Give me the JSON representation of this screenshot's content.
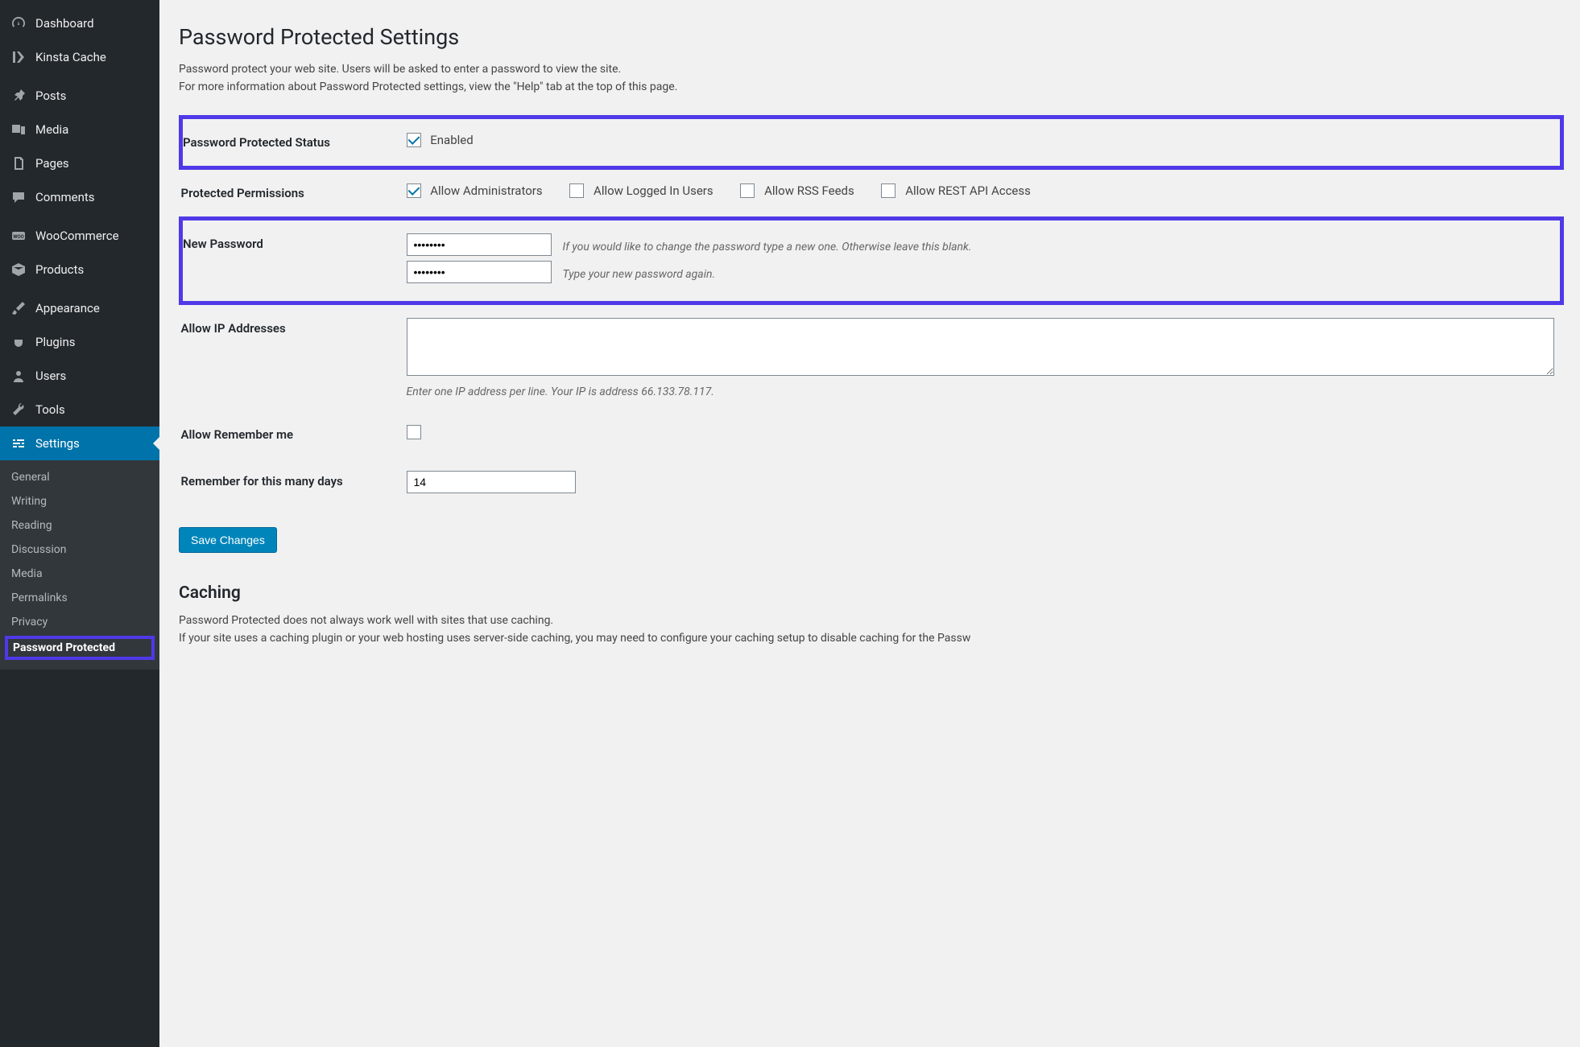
{
  "sidebar": {
    "items": [
      {
        "label": "Dashboard",
        "icon": "dashboard"
      },
      {
        "label": "Kinsta Cache",
        "icon": "kinsta"
      },
      {
        "label": "Posts",
        "icon": "pin"
      },
      {
        "label": "Media",
        "icon": "media"
      },
      {
        "label": "Pages",
        "icon": "pages"
      },
      {
        "label": "Comments",
        "icon": "comment"
      },
      {
        "label": "WooCommerce",
        "icon": "woo"
      },
      {
        "label": "Products",
        "icon": "box"
      },
      {
        "label": "Appearance",
        "icon": "brush"
      },
      {
        "label": "Plugins",
        "icon": "plug"
      },
      {
        "label": "Users",
        "icon": "user"
      },
      {
        "label": "Tools",
        "icon": "wrench"
      },
      {
        "label": "Settings",
        "icon": "sliders",
        "current": true
      }
    ],
    "submenu": [
      "General",
      "Writing",
      "Reading",
      "Discussion",
      "Media",
      "Permalinks",
      "Privacy"
    ],
    "submenu_current": "Password Protected"
  },
  "page": {
    "title": "Password Protected Settings",
    "intro_line1": "Password protect your web site. Users will be asked to enter a password to view the site.",
    "intro_line2": "For more information about Password Protected settings, view the \"Help\" tab at the top of this page."
  },
  "form": {
    "status_label": "Password Protected Status",
    "status_enabled_label": "Enabled",
    "status_enabled": true,
    "perms_label": "Protected Permissions",
    "perms": [
      {
        "label": "Allow Administrators",
        "checked": true
      },
      {
        "label": "Allow Logged In Users",
        "checked": false
      },
      {
        "label": "Allow RSS Feeds",
        "checked": false
      },
      {
        "label": "Allow REST API Access",
        "checked": false
      }
    ],
    "newpwd_label": "New Password",
    "pwd1_help": "If you would like to change the password type a new one. Otherwise leave this blank.",
    "pwd2_help": "Type your new password again.",
    "allow_ip_label": "Allow IP Addresses",
    "allow_ip_desc": "Enter one IP address per line. Your IP is address 66.133.78.117.",
    "remember_label": "Allow Remember me",
    "remember_checked": false,
    "remember_days_label": "Remember for this many days",
    "remember_days_value": "14",
    "save_label": "Save Changes"
  },
  "caching": {
    "heading": "Caching",
    "line1": "Password Protected does not always work well with sites that use caching.",
    "line2": "If your site uses a caching plugin or your web hosting uses server-side caching, you may need to configure your caching setup to disable caching for the Passw"
  }
}
